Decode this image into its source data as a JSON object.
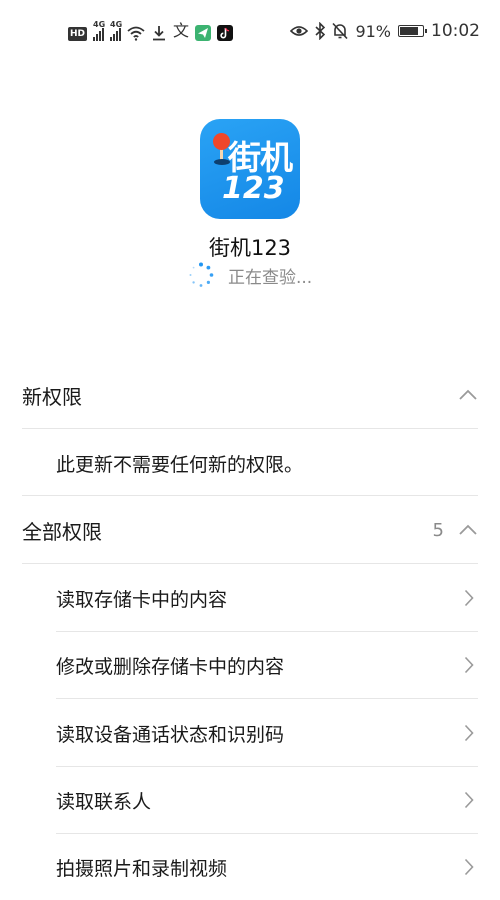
{
  "status_bar": {
    "hd_label": "HD",
    "network_1": "4G",
    "network_2": "4G",
    "icons_left": [
      "hd-icon",
      "signal-icon",
      "signal-icon",
      "wifi-icon",
      "download-icon",
      "translate-icon",
      "paper-plane-icon",
      "tiktok-icon"
    ],
    "icons_right": [
      "eye-icon",
      "bluetooth-icon",
      "mute-bell-icon",
      "battery-icon"
    ],
    "battery_percent": "91%",
    "battery_level": 0.91,
    "time": "10:02"
  },
  "app": {
    "icon_line1": "街机",
    "icon_line2": "123",
    "name": "街机123",
    "status": "正在查验..."
  },
  "new_permissions": {
    "title": "新权限",
    "expanded": true,
    "note": "此更新不需要任何新的权限。"
  },
  "all_permissions": {
    "title": "全部权限",
    "count": "5",
    "expanded": true,
    "items": [
      {
        "label": "读取存储卡中的内容"
      },
      {
        "label": "修改或删除存储卡中的内容"
      },
      {
        "label": "读取设备通话状态和识别码"
      },
      {
        "label": "读取联系人"
      },
      {
        "label": "拍摄照片和录制视频"
      }
    ]
  },
  "colors": {
    "icon_blue": "#1f97ee",
    "pin_red": "#f0472a",
    "spinner_blue": "#2196f3",
    "muted_text": "#8a8a8a",
    "divider": "#e6e6e6"
  }
}
